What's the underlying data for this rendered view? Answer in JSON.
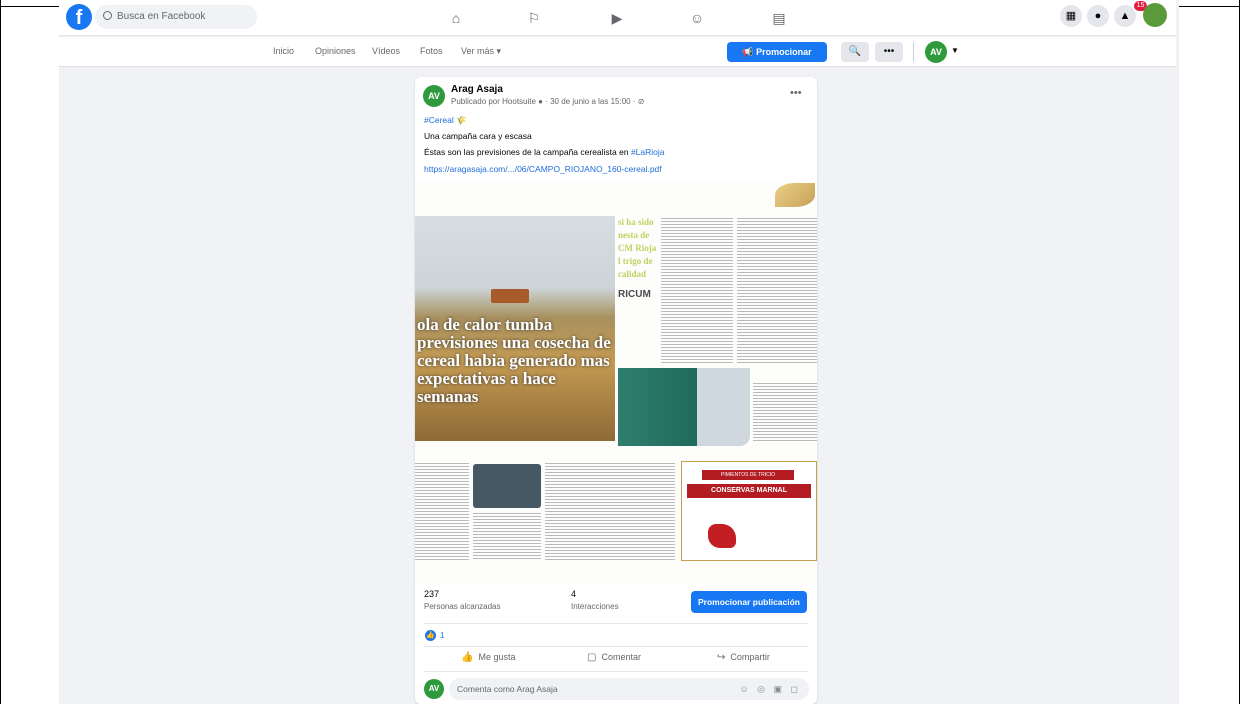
{
  "topbar": {
    "logo_letter": "f",
    "search_placeholder": "Busca en Facebook",
    "nav_icons": [
      "home-icon",
      "flag-icon",
      "video-icon",
      "groups-icon",
      "gaming-icon"
    ],
    "right_icons": [
      "menu-grid-icon",
      "messenger-icon",
      "notifications-icon"
    ],
    "notifications_badge": "15"
  },
  "subnav": {
    "tabs": [
      "Inicio",
      "Opiniones",
      "Vídeos",
      "Fotos",
      "Ver más ▾"
    ],
    "promote_label": "📢 Promocionar",
    "search_icon": "🔍",
    "more_icon": "•••",
    "page_avatar": "AV",
    "caret": "▼"
  },
  "post": {
    "avatar": "AV",
    "author": "Arag Asaja",
    "meta": "Publicado por Hootsuite ● · 30 de junio a las 15:00 · ⊘",
    "menu": "•••",
    "hashtag_line": "#Cereal 🌾",
    "line1": "Una campaña cara y escasa",
    "line2_prefix": "Éstas son las previsiones de la campaña cerealista en ",
    "line2_tag": "#LaRioja",
    "link": "https://aragasaja.com/.../06/CAMPO_RIOJANO_160-cereal.pdf"
  },
  "document": {
    "headline": "ola de calor tumba previsiones una cosecha de cereal habia generado mas expectativas a hace semanas",
    "green_head": "si ha sido nesta de CM Rioja l trigo de calidad",
    "logo_text": "RICUM",
    "ad_title": "PIMIENTOS DE TRICIO",
    "ad_brand": "CONSERVAS MARNAL"
  },
  "stats": {
    "reached_count": "237",
    "reached_label": "Personas alcanzadas",
    "interactions_count": "4",
    "interactions_label": "Interacciones",
    "boost_label": "Promocionar publicación"
  },
  "reactions": {
    "like_icon": "👍",
    "count": "1"
  },
  "actions": {
    "like": "Me gusta",
    "comment": "Comentar",
    "share": "Compartir"
  },
  "comment": {
    "avatar": "AV",
    "placeholder": "Comenta como Arag Asaja",
    "icons": "☺ ◎ ▣ ◻"
  },
  "colors": {
    "brand_blue": "#1877f2",
    "page_bg": "#f0f2f5",
    "avatar_green": "#2f9a3d"
  }
}
